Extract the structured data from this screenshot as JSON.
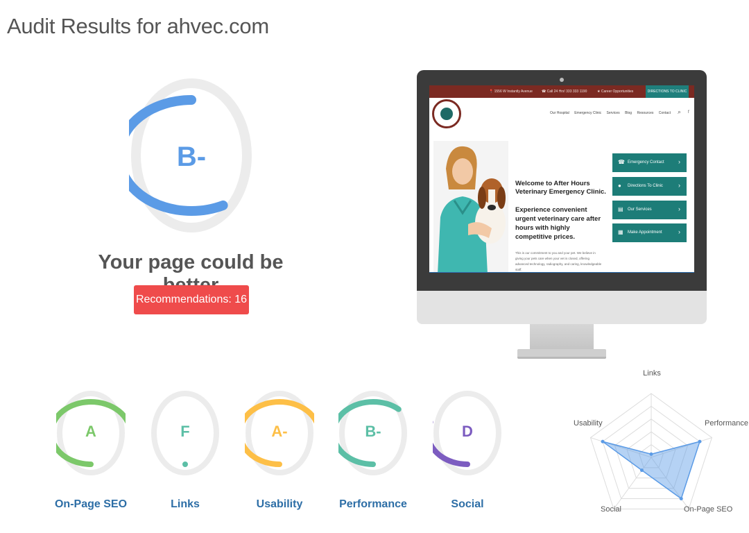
{
  "page": {
    "title": "Audit Results for ahvec.com"
  },
  "summary": {
    "overall_grade": "B-",
    "overall_score": 0.58,
    "message": "Your page could be better",
    "recommendations_label": "Recommendations: 16"
  },
  "preview": {
    "topbar": {
      "address": "1556 W Instantly Avenue",
      "phone": "Call 24 Hrs! 333 333 1190",
      "careers": "Career Opportunities",
      "cta": "DIRECTIONS TO CLINIC"
    },
    "nav": [
      "Our Hospital",
      "Emergency Clinic",
      "Services",
      "Blog",
      "Resources",
      "Contact"
    ],
    "hero": {
      "title": "Welcome to After Hours Veterinary Emergency Clinic.",
      "subtitle": "Experience convenient urgent veterinary care after hours with highly competitive prices.",
      "body": "This is our commitment to you and your pet. We believe in giving your pets care when your vet is closed, offering advanced technology, radiography, and caring, knowledgeable staff."
    },
    "buttons": [
      {
        "label": "Emergency Contact",
        "icon": "phone-icon"
      },
      {
        "label": "Directions To Clinic",
        "icon": "map-pin-icon"
      },
      {
        "label": "Our Services",
        "icon": "document-icon"
      },
      {
        "label": "Make Appointment",
        "icon": "calendar-icon"
      }
    ]
  },
  "categories": [
    {
      "key": "onpage",
      "grade": "A",
      "label": "On-Page SEO",
      "score": 0.75,
      "color": "#7cc86a"
    },
    {
      "key": "links",
      "grade": "F",
      "label": "Links",
      "score": 0.0,
      "color": "#5cbfa6"
    },
    {
      "key": "usability",
      "grade": "A-",
      "label": "Usability",
      "score": 0.75,
      "color": "#fdbf47"
    },
    {
      "key": "performance",
      "grade": "B-",
      "label": "Performance",
      "score": 0.62,
      "color": "#5cbfa6"
    },
    {
      "key": "social",
      "grade": "D",
      "label": "Social",
      "score": 0.3,
      "color": "#7c5cc0"
    }
  ],
  "colors": {
    "accent_blue": "#5b9be6",
    "reco_red": "#ef4b4b",
    "track_gray": "#ececec",
    "label_blue": "#2d6ea6",
    "teal": "#1d7d78"
  },
  "chart_data": {
    "type": "radar",
    "axes": [
      "Links",
      "Performance",
      "On-Page SEO",
      "Social",
      "Usability"
    ],
    "values": [
      0.05,
      0.8,
      0.8,
      0.25,
      0.8
    ],
    "range": [
      0,
      1
    ],
    "rings": 5,
    "fill_color": "#5b9be6"
  }
}
